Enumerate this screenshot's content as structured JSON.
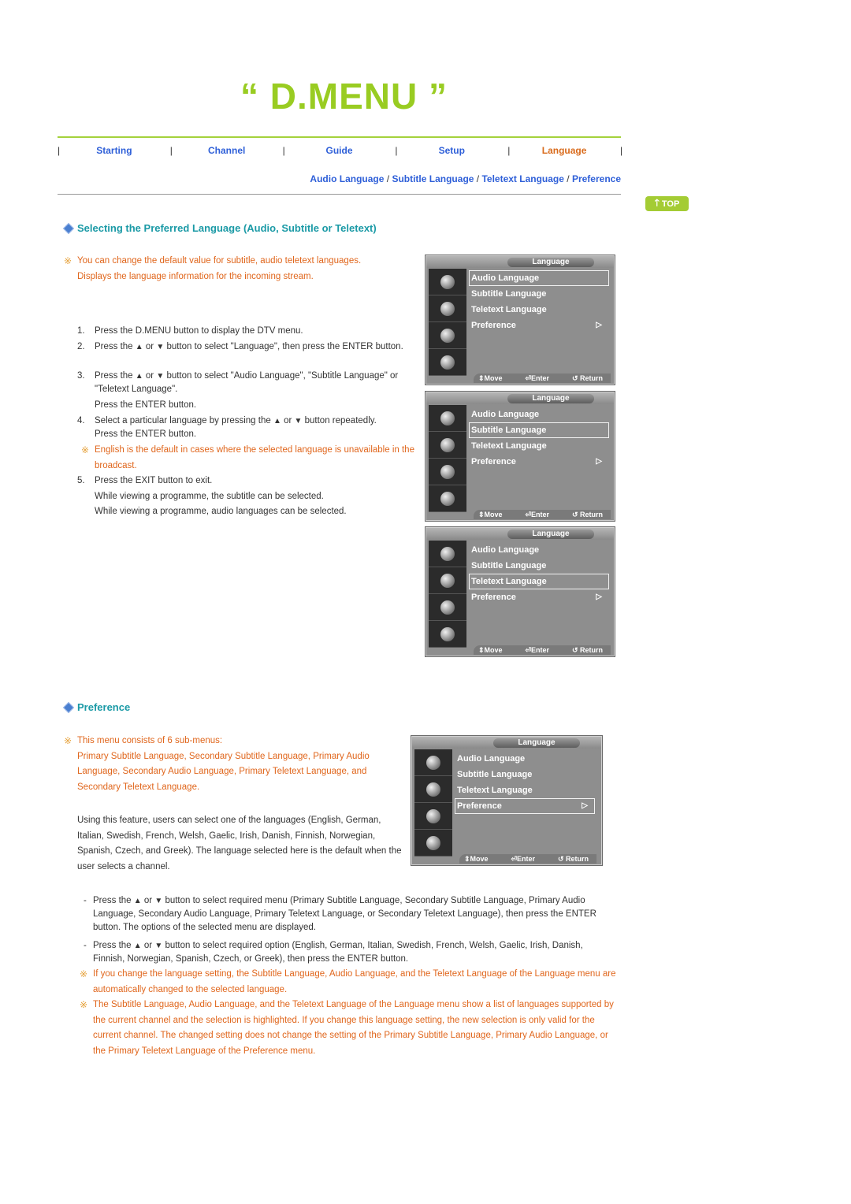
{
  "title": "“ D.MENU ”",
  "nav": {
    "items": [
      {
        "label": "Starting",
        "active": false
      },
      {
        "label": "Channel",
        "active": false
      },
      {
        "label": "Guide",
        "active": false
      },
      {
        "label": "Setup",
        "active": false
      },
      {
        "label": "Language",
        "active": true
      }
    ],
    "separator": "|"
  },
  "subnav": {
    "items": [
      "Audio Language",
      "Subtitle Language",
      "Teletext Language",
      "Preference"
    ],
    "separator": " / "
  },
  "top_button": {
    "label": "TOP",
    "icon": "arrow-up-icon"
  },
  "section1": {
    "heading": "Selecting the Preferred Language (Audio, Subtitle or Teletext)",
    "note_lines": [
      "You can change the default value for subtitle, audio teletext languages.",
      "Displays the language information for the incoming stream."
    ],
    "steps": [
      {
        "num": "1.",
        "text": "Press the D.MENU button to display the DTV menu."
      },
      {
        "num": "2.",
        "text_pre": "Press the",
        "text_mid": "or",
        "text_post": "button to select \"Language\", then press the ENTER button."
      },
      {
        "num": "3.",
        "text_pre": "Press the",
        "text_mid": "or",
        "text_post": "button to select \"Audio Language\", \"Subtitle Language\" or \"Teletext Language\".",
        "extra": "Press the ENTER button."
      },
      {
        "num": "4.",
        "text_pre": "Select a particular language by pressing the",
        "text_mid": "or",
        "text_post": "button repeatedly.",
        "extra": "Press the ENTER button."
      },
      {
        "num": "5.",
        "text": "Press the EXIT button to exit.",
        "extra1": "While viewing a programme, the subtitle can be selected.",
        "extra2": "While viewing a programme, audio languages can be selected."
      }
    ],
    "step4_note": "English is the default in cases where the selected language is unavailable in the broadcast."
  },
  "osd": {
    "header": "Language",
    "items": [
      "Audio Language",
      "Subtitle Language",
      "Teletext Language",
      "Preference"
    ],
    "footer": {
      "move": "Move",
      "enter": "Enter",
      "return": "Return"
    },
    "screens": [
      {
        "selected": "Audio Language"
      },
      {
        "selected": "Subtitle Language"
      },
      {
        "selected": "Teletext Language"
      },
      {
        "selected": "Preference"
      }
    ]
  },
  "section2": {
    "heading": "Preference",
    "note_intro": "This menu consists of 6 sub-menus:",
    "note_body": "Primary Subtitle Language, Secondary Subtitle Language, Primary Audio Language, Secondary Audio Language, Primary Teletext Language, and Secondary Teletext Language.",
    "paragraph": "Using this feature, users can select one of the languages (English, German, Italian, Swedish, French, Welsh, Gaelic, Irish, Danish, Finnish, Norwegian, Spanish, Czech, and Greek). The language selected here is the default when the user selects a channel.",
    "bullets": [
      {
        "pre": "Press the",
        "mid": "or",
        "post": "button to select required menu (Primary Subtitle Language, Secondary Subtitle Language, Primary Audio Language, Secondary Audio Language, Primary Teletext Language, or Secondary Teletext Language), then press the ENTER button. The options of the selected menu are displayed."
      },
      {
        "pre": "Press the",
        "mid": "or",
        "post": "button to select required option (English, German, Italian, Swedish, French, Welsh, Gaelic, Irish, Danish, Finnish, Norwegian, Spanish, Czech, or Greek), then press the ENTER button."
      }
    ],
    "notes": [
      "If you change the language setting, the Subtitle Language, Audio Language, and the Teletext Language of the Language menu are automatically changed to the selected language.",
      "The Subtitle Language, Audio Language, and the Teletext Language of the Language menu show a list of languages supported by the current channel and the selection is highlighted. If you change this language setting, the new selection is only valid for the current channel. The changed setting does not change the setting of the Primary Subtitle Language, Primary Audio Language, or the Primary Teletext Language of the Preference menu."
    ]
  },
  "colors": {
    "title_green": "#99cc22",
    "link_blue": "#2e5fd8",
    "active_orange": "#d96b1c",
    "heading_teal": "#1b9aa6",
    "note_orange": "#e0661c"
  }
}
